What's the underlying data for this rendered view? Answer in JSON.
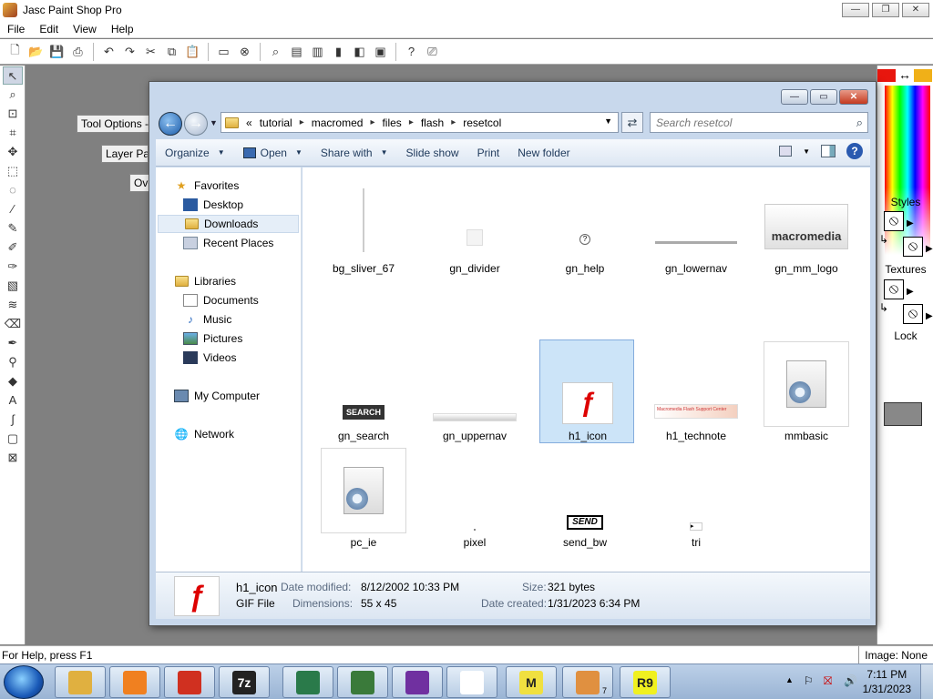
{
  "app": {
    "title": "Jasc Paint Shop Pro",
    "menu": [
      "File",
      "Edit",
      "View",
      "Help"
    ],
    "window_controls": {
      "minimize": "—",
      "restore": "❐",
      "close": "✕"
    }
  },
  "palettes": {
    "tool_options": "Tool Options -",
    "layer_palette": "Layer Pal",
    "overview": "Ove"
  },
  "right_panel": {
    "styles_label": "Styles",
    "textures_label": "Textures",
    "lock_label": "Lock",
    "fg_color": "#e8160e",
    "bg_color": "#f0b018"
  },
  "status": {
    "help": "For Help, press F1",
    "image": "Image: None"
  },
  "explorer": {
    "breadcrumb_prefix": "«",
    "breadcrumb": [
      "tutorial",
      "macromed",
      "files",
      "flash",
      "resetcol"
    ],
    "search_placeholder": "Search resetcol",
    "commands": {
      "organize": "Organize",
      "open": "Open",
      "share_with": "Share with",
      "slide_show": "Slide show",
      "print": "Print",
      "new_folder": "New folder"
    },
    "nav": {
      "favorites": "Favorites",
      "desktop": "Desktop",
      "downloads": "Downloads",
      "recent_places": "Recent Places",
      "libraries": "Libraries",
      "documents": "Documents",
      "music": "Music",
      "pictures": "Pictures",
      "videos": "Videos",
      "my_computer": "My Computer",
      "network": "Network"
    },
    "files": [
      {
        "name": "bg_sliver_67"
      },
      {
        "name": "gn_divider"
      },
      {
        "name": "gn_help"
      },
      {
        "name": "gn_lowernav"
      },
      {
        "name": "gn_mm_logo",
        "thumb_text": "macromedia"
      },
      {
        "name": "gn_search",
        "thumb_text": "SEARCH"
      },
      {
        "name": "gn_uppernav"
      },
      {
        "name": "h1_icon",
        "selected": true
      },
      {
        "name": "h1_technote",
        "thumb_text": "Macromedia Flash Support Center"
      },
      {
        "name": "mmbasic"
      },
      {
        "name": "pc_ie"
      },
      {
        "name": "pixel"
      },
      {
        "name": "send_bw",
        "thumb_text": "SEND"
      },
      {
        "name": "tri"
      }
    ],
    "details": {
      "name": "h1_icon",
      "type": "GIF File",
      "date_modified_label": "Date modified:",
      "date_modified": "8/12/2002 10:33 PM",
      "dimensions_label": "Dimensions:",
      "dimensions": "55 x 45",
      "size_label": "Size:",
      "size": "321 bytes",
      "date_created_label": "Date created:",
      "date_created": "1/31/2023 6:34 PM"
    }
  },
  "taskbar": {
    "time": "7:11 PM",
    "date": "1/31/2023",
    "apps": [
      {
        "icon": "file-explorer-icon",
        "color": "#e0b040"
      },
      {
        "icon": "media-player-icon",
        "color": "#f08020"
      },
      {
        "icon": "chrome-icon",
        "color": "#d03020"
      },
      {
        "icon": "7zip-icon",
        "glyph": "7z",
        "color": "#222222"
      },
      {
        "icon": "photo-editor-icon",
        "color": "#2a7a4a"
      },
      {
        "icon": "hardware-icon",
        "color": "#3a7a3a"
      },
      {
        "icon": "help-book-icon",
        "color": "#7030a0"
      },
      {
        "icon": "notepad-list-icon",
        "color": "#ffffff"
      },
      {
        "icon": "m-app-icon",
        "glyph": "M",
        "color": "#f0e040"
      },
      {
        "icon": "paint-shop-pro-icon",
        "badge": "7",
        "color": "#e09040"
      },
      {
        "icon": "r9-icon",
        "glyph": "R9",
        "color": "#f0f020"
      }
    ]
  }
}
